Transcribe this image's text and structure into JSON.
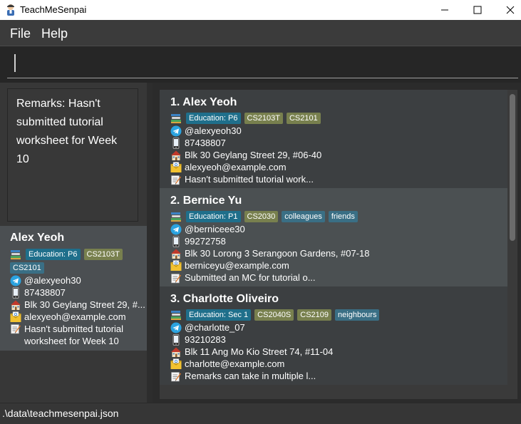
{
  "window": {
    "title": "TeachMeSenpai"
  },
  "menu": {
    "file": "File",
    "help": "Help"
  },
  "command": {
    "value": ""
  },
  "remarks_panel": {
    "text": "Remarks: Hasn't submitted tutorial worksheet for Week 10"
  },
  "detail": {
    "name": "Alex Yeoh",
    "education": "Education: P6",
    "tags": [
      "CS2103T",
      "CS2101"
    ],
    "telegram": "@alexyeoh30",
    "phone": "87438807",
    "address": "Blk 30 Geylang Street 29, #...",
    "email": "alexyeoh@example.com",
    "remark": "Hasn't submitted tutorial worksheet for Week 10"
  },
  "students": [
    {
      "index": "1.",
      "name": "Alex Yeoh",
      "education": "Education: P6",
      "tags": [
        "CS2103T",
        "CS2101"
      ],
      "telegram": "@alexyeoh30",
      "phone": "87438807",
      "address": "Blk 30 Geylang Street 29, #06-40",
      "email": "alexyeoh@example.com",
      "remark": "Hasn't submitted tutorial work..."
    },
    {
      "index": "2.",
      "name": "Bernice Yu",
      "education": "Education: P1",
      "tags": [
        "CS2030",
        "colleagues",
        "friends"
      ],
      "telegram": "@berniceee30",
      "phone": "99272758",
      "address": "Blk 30 Lorong 3 Serangoon Gardens, #07-18",
      "email": "berniceyu@example.com",
      "remark": "Submitted an MC for tutorial o..."
    },
    {
      "index": "3.",
      "name": "Charlotte Oliveiro",
      "education": "Education: Sec 1",
      "tags": [
        "CS2040S",
        "CS2109",
        "neighbours"
      ],
      "telegram": "@charlotte_07",
      "phone": "93210283",
      "address": "Blk 11 Ang Mo Kio Street 74, #11-04",
      "email": "charlotte@example.com",
      "remark": "Remarks can take in multiple l..."
    }
  ],
  "status": {
    "path": ".\\data\\teachmesenpai.json"
  },
  "icons": {
    "education": "books-icon",
    "telegram": "telegram-icon",
    "phone": "phone-icon",
    "address": "house-icon",
    "email": "envelope-icon",
    "remark": "note-icon"
  },
  "colors": {
    "education_tag": "#1f6f8b",
    "module_tag": "#78804e",
    "other_tag": "#3a6f85",
    "selected_card": "#4b5052"
  }
}
